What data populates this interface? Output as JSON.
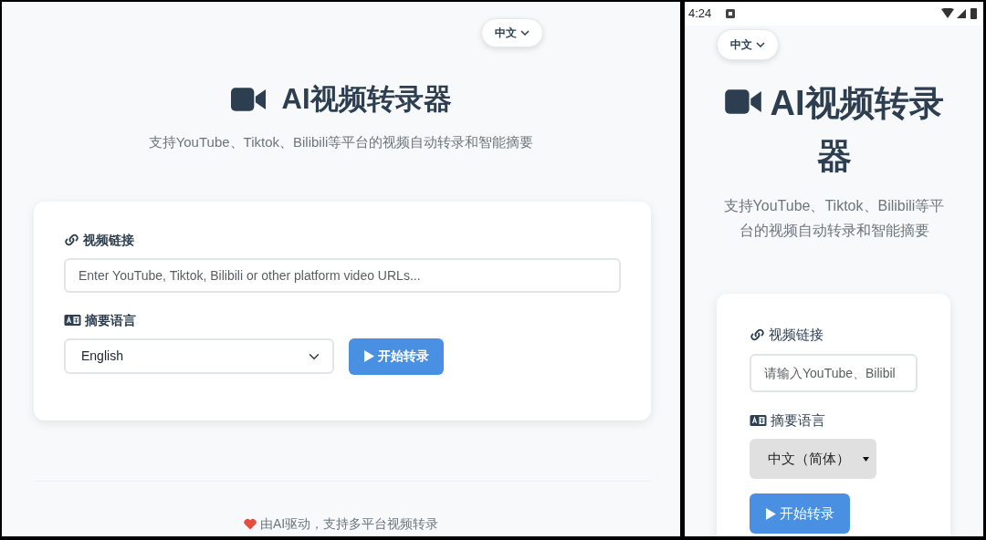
{
  "desktop": {
    "language_button": "中文",
    "title": "AI视频转录器",
    "subtitle": "支持YouTube、Tiktok、Bilibili等平台的视频自动转录和智能摘要",
    "form": {
      "url_label": "视频链接",
      "url_placeholder": "Enter YouTube, Tiktok, Bilibili or other platform video URLs...",
      "language_label": "摘要语言",
      "language_value": "English",
      "submit": "开始转录"
    },
    "footer": "由AI驱动，支持多平台视频转录"
  },
  "mobile": {
    "status_bar": {
      "time": "4:24"
    },
    "language_button": "中文",
    "title": "AI视频转录器",
    "subtitle": "支持YouTube、Tiktok、Bilibili等平台的视频自动转录和智能摘要",
    "form": {
      "url_label": "视频链接",
      "url_placeholder": "请输入YouTube、Bilibil",
      "language_label": "摘要语言",
      "language_value": "中文（简体）",
      "submit": "开始转录"
    }
  }
}
